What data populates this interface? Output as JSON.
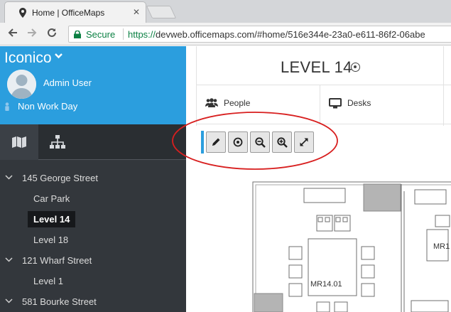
{
  "browser": {
    "tab_title": "Home | OfficeMaps",
    "tab_close": "✕",
    "secure_label": "Secure",
    "url_scheme": "https://",
    "url_rest": "devweb.officemaps.com/#home/516e344e-23a0-e611-86f2-06abe"
  },
  "sidebar": {
    "brand": "Iconico",
    "brand_caret": "⌄",
    "user_name": "Admin User",
    "status": "Non Work Day",
    "tree": [
      {
        "label": "145 George Street",
        "expandable": true
      },
      {
        "label": "Car Park"
      },
      {
        "label": "Level 14",
        "selected": true
      },
      {
        "label": "Level 18"
      },
      {
        "label": "121 Wharf Street",
        "expandable": true
      },
      {
        "label": "Level 1"
      },
      {
        "label": "581 Bourke Street",
        "expandable": true
      }
    ]
  },
  "main": {
    "level_title": "LEVEL 14",
    "tabs": [
      {
        "label": "People",
        "icon": "people-icon"
      },
      {
        "label": "Desks",
        "icon": "monitor-icon"
      }
    ],
    "toolbar": [
      "pencil-icon",
      "target-icon",
      "zoom-out-icon",
      "zoom-in-icon",
      "expand-icon"
    ],
    "map": {
      "room_a": "MR14.01",
      "room_b": "MR1"
    }
  },
  "colors": {
    "accent": "#2b9ede",
    "sidebar_dark": "#33373c",
    "highlight_ellipse": "#d81f1f"
  }
}
